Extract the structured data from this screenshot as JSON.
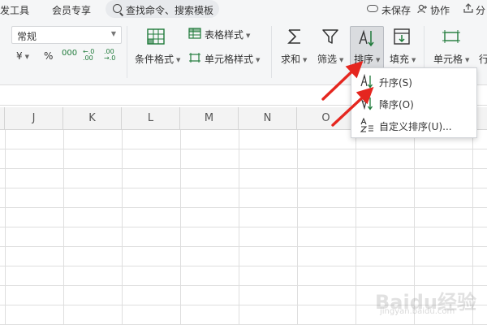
{
  "menubar": {
    "tabs": [
      "发工具",
      "会员专享"
    ],
    "search_text": "查找命令、搜索模板",
    "unsaved_label": "未保存",
    "collab_label": "协作",
    "share_label": "分"
  },
  "ribbon": {
    "number_format": "常规",
    "currency_symbol": "¥",
    "percent_symbol": "%",
    "thousands_symbol": "000",
    "decimal_increase": "←.0\n.00",
    "decimal_decrease": ".00\n→.0",
    "conditional_format": "条件格式",
    "table_style": "表格样式",
    "cell_style": "单元格样式",
    "sum": "求和",
    "filter": "筛选",
    "sort": "排序",
    "fill": "填充",
    "cells": "单元格",
    "rows": "行"
  },
  "grid": {
    "columns": [
      "J",
      "K",
      "L",
      "M",
      "N",
      "O"
    ]
  },
  "sort_menu": {
    "items": [
      {
        "label": "升序(S)",
        "icon": "sort-ascending-icon"
      },
      {
        "label": "降序(O)",
        "icon": "sort-descending-icon"
      },
      {
        "label": "自定义排序(U)...",
        "icon": "custom-sort-icon"
      }
    ]
  },
  "watermark": {
    "brand": "Baidu经验",
    "url": "jingyan.baidu.com"
  },
  "colors": {
    "accent_green": "#1f7a3a",
    "arrow_red": "#e5261f",
    "ribbon_bg": "#f5f6f7"
  }
}
